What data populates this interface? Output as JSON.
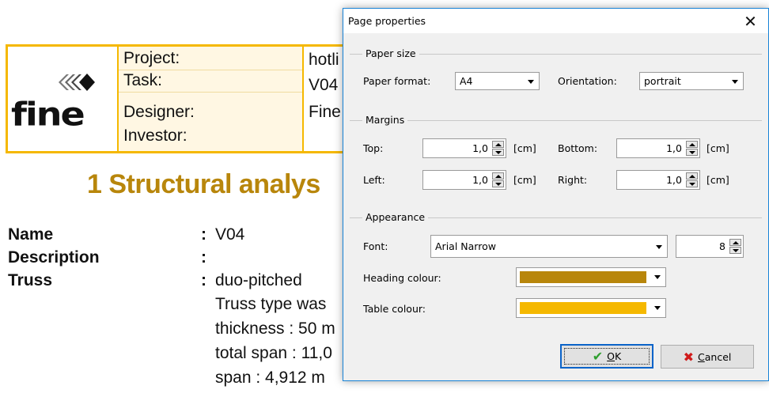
{
  "document": {
    "header": {
      "labels": [
        "Project:",
        "Task:",
        "Designer:",
        "Investor:"
      ],
      "values": [
        "hotli",
        "V04",
        "Fine",
        ""
      ]
    },
    "logo_text": "fine",
    "section_title": "1 Structural analys",
    "properties": [
      {
        "label": "Name",
        "colon": ":",
        "value": "V04"
      },
      {
        "label": "Description",
        "colon": ":",
        "value": ""
      },
      {
        "label": "Truss",
        "colon": ":",
        "value": "duo-pitched"
      }
    ],
    "truss_lines": [
      "Truss type was",
      "thickness : 50 m",
      "total span : 11,0",
      "span : 4,912 m"
    ]
  },
  "dialog": {
    "title": "Page properties",
    "close_label": "✕",
    "paper_size": {
      "group_title": "Paper size",
      "format_label": "Paper format:",
      "format_value": "A4",
      "orientation_label": "Orientation:",
      "orientation_value": "portrait"
    },
    "margins": {
      "group_title": "Margins",
      "top_label": "Top:",
      "top_value": "1,0",
      "bottom_label": "Bottom:",
      "bottom_value": "1,0",
      "left_label": "Left:",
      "left_value": "1,0",
      "right_label": "Right:",
      "right_value": "1,0",
      "unit": "[cm]"
    },
    "appearance": {
      "group_title": "Appearance",
      "font_label": "Font:",
      "font_value": "Arial Narrow",
      "font_size": "8",
      "heading_colour_label": "Heading colour:",
      "heading_colour": "#b8860b",
      "table_colour_label": "Table colour:",
      "table_colour": "#f5b800"
    },
    "buttons": {
      "ok_underlined": "O",
      "ok_rest": "K",
      "cancel_underlined": "C",
      "cancel_rest": "ancel"
    }
  },
  "icons": {
    "close": "close-icon",
    "ok": "checkmark-icon",
    "cancel": "x-icon"
  }
}
